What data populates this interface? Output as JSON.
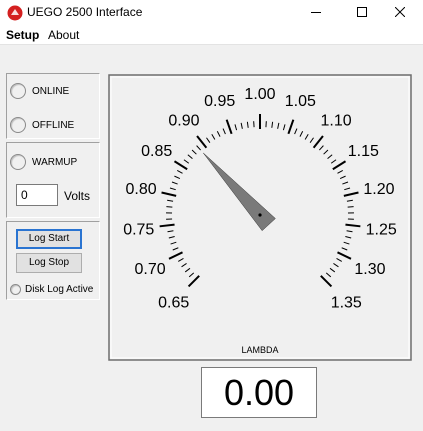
{
  "window": {
    "title": "UEGO 2500 Interface"
  },
  "menu": {
    "items": [
      "Setup",
      "About"
    ]
  },
  "status": {
    "online_label": "ONLINE",
    "offline_label": "OFFLINE",
    "warmup_label": "WARMUP"
  },
  "voltage": {
    "value": "0",
    "unit_label": "Volts"
  },
  "logging": {
    "start_label": "Log Start",
    "stop_label": "Log Stop",
    "disk_log_label": "Disk Log Active"
  },
  "gauge": {
    "label": "LAMBDA",
    "min": 0.65,
    "max": 1.35,
    "major_step": 0.05,
    "minor_per_major": 5,
    "tick_labels": [
      "0.65",
      "0.70",
      "0.75",
      "0.80",
      "0.85",
      "0.90",
      "0.95",
      "1.00",
      "1.05",
      "1.10",
      "1.15",
      "1.20",
      "1.25",
      "1.30",
      "1.35"
    ],
    "needle_value": 0.89
  },
  "readout": {
    "value": "0.00"
  },
  "colors": {
    "icon_red": "#d42020",
    "focus_blue": "#2a74d1"
  }
}
